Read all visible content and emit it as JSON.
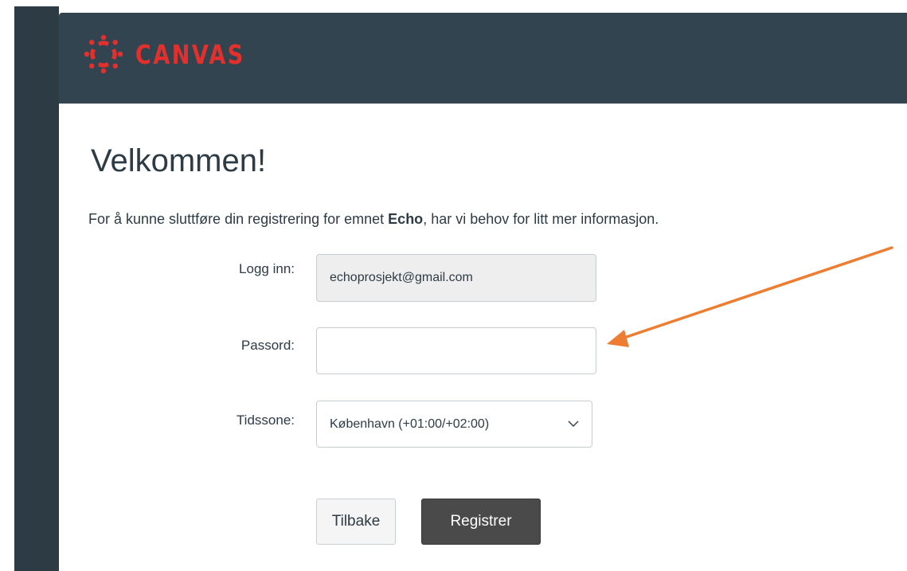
{
  "header": {
    "logo_text": "CANVAS",
    "logo_color": "#e4302c",
    "background": "#334451"
  },
  "main": {
    "title": "Velkommen!",
    "intro_before": "For å kunne sluttføre din registrering for emnet ",
    "intro_course": "Echo",
    "intro_after": ", har vi behov for litt mer informasjon."
  },
  "form": {
    "login_label": "Logg inn:",
    "login_value": "echoprosjekt@gmail.com",
    "password_label": "Passord:",
    "password_value": "",
    "timezone_label": "Tidssone:",
    "timezone_value": "København (+01:00/+02:00)"
  },
  "buttons": {
    "back_label": "Tilbake",
    "register_label": "Registrer"
  },
  "annotation": {
    "arrow_color": "#ed7d31"
  }
}
